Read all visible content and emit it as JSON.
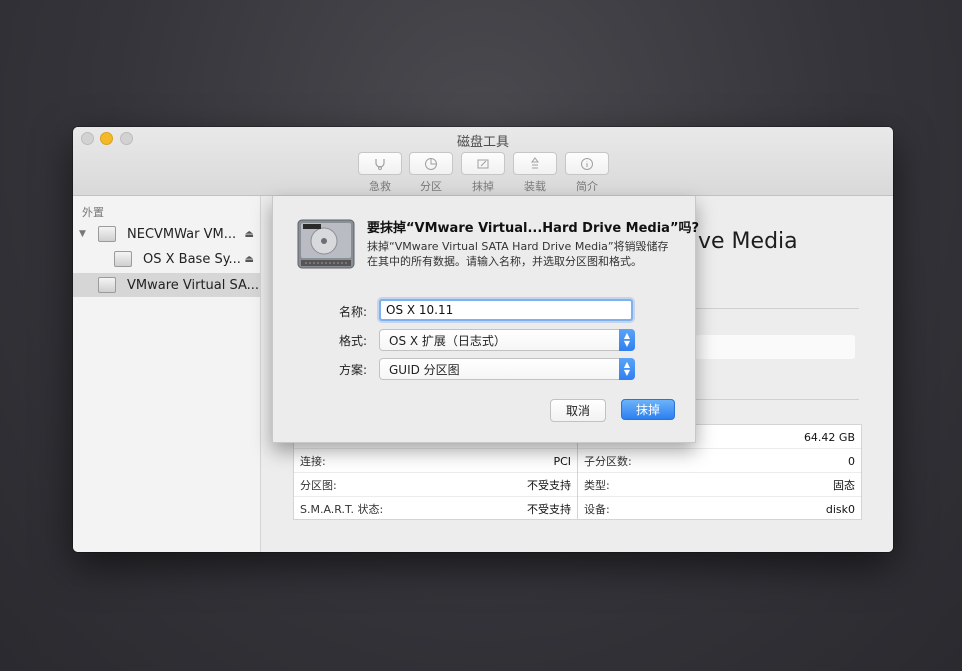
{
  "window": {
    "title": "磁盘工具"
  },
  "toolbar": {
    "items": [
      {
        "label": "急救",
        "icon": "stethoscope-icon"
      },
      {
        "label": "分区",
        "icon": "partition-pie-icon"
      },
      {
        "label": "抹掉",
        "icon": "erase-icon"
      },
      {
        "label": "装载",
        "icon": "mount-icon"
      },
      {
        "label": "简介",
        "icon": "info-icon"
      }
    ]
  },
  "sidebar": {
    "section": "外置",
    "items": [
      {
        "label": "NECVMWar VM...",
        "eject": "⏏"
      },
      {
        "label": "OS X Base Sy...",
        "eject": "⏏"
      },
      {
        "label": "VMware Virtual SA..."
      }
    ]
  },
  "main": {
    "title_partial": "ve Media",
    "info_left": [
      {
        "key": "连接:",
        "value": "PCI"
      },
      {
        "key": "分区图:",
        "value": "不受支持"
      },
      {
        "key": "S.M.A.R.T. 状态:",
        "value": "不受支持"
      }
    ],
    "info_right": [
      {
        "key": "",
        "value": "64.42 GB"
      },
      {
        "key": "子分区数:",
        "value": "0"
      },
      {
        "key": "类型:",
        "value": "固态"
      },
      {
        "key": "设备:",
        "value": "disk0"
      }
    ]
  },
  "dialog": {
    "title": "要抹掉“VMware Virtual...Hard Drive Media”吗?",
    "description": "抹掉“VMware Virtual SATA Hard Drive Media”将销毁储存在其中的所有数据。请输入名称，并选取分区图和格式。",
    "name_label": "名称:",
    "name_value": "OS X 10.11",
    "format_label": "格式:",
    "format_value": "OS X 扩展（日志式）",
    "scheme_label": "方案:",
    "scheme_value": "GUID 分区图",
    "cancel_label": "取消",
    "erase_label": "抹掉"
  },
  "colors": {
    "accent": "#2f7ff0",
    "minimize": "#f5b928"
  }
}
